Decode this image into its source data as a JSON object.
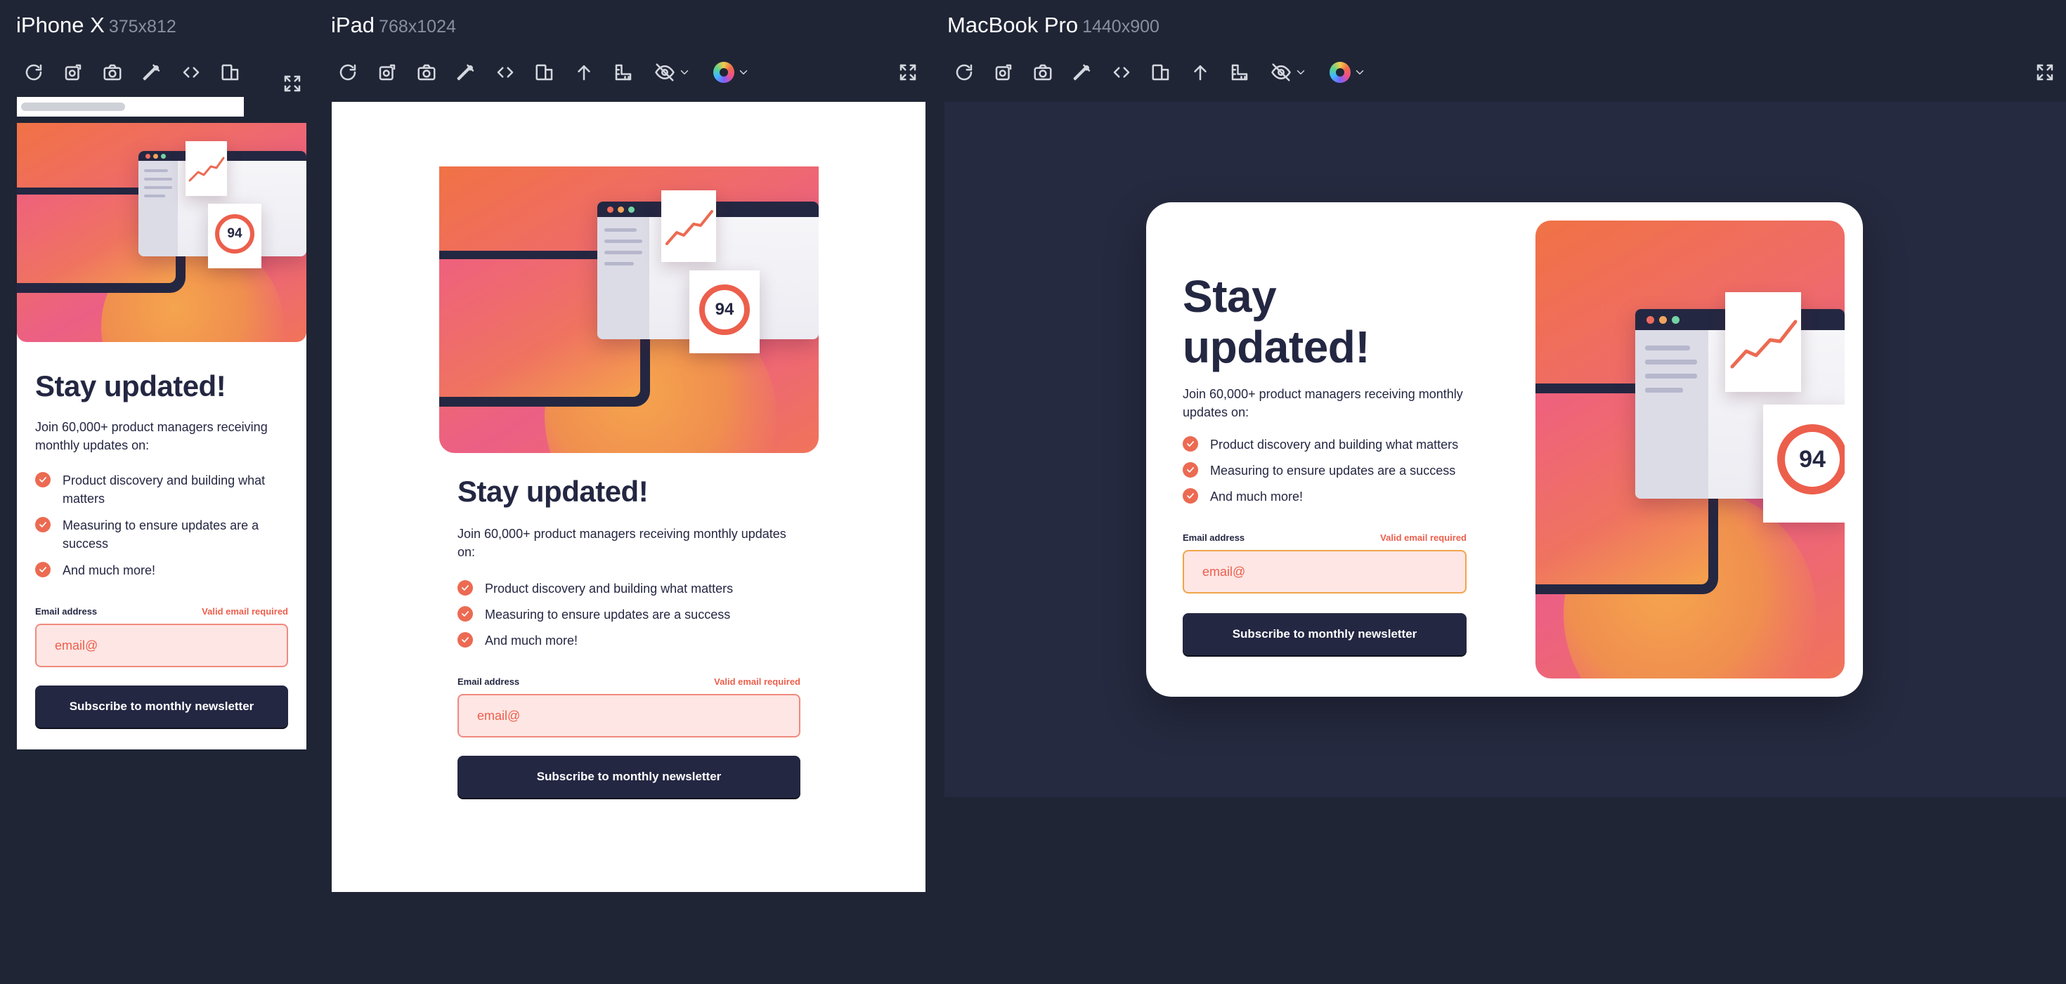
{
  "devices": {
    "iphone": {
      "name": "iPhone X",
      "dims": "375x812"
    },
    "ipad": {
      "name": "iPad",
      "dims": "768x1024"
    },
    "macbook": {
      "name": "MacBook Pro",
      "dims": "1440x900"
    }
  },
  "toolbar_icons": [
    "refresh-icon",
    "screenshot-target-icon",
    "camera-icon",
    "eyedropper-icon",
    "code-icon",
    "device-frame-icon",
    "arrow-up-icon",
    "ruler-icon",
    "eye-off-icon",
    "color-palette-icon",
    "fullscreen-icon"
  ],
  "newsletter": {
    "title": "Stay updated!",
    "intro": "Join 60,000+ product managers receiving monthly updates on:",
    "features": [
      "Product discovery and building what matters",
      "Measuring to ensure updates are a success",
      "And much more!"
    ],
    "email_label": "Email address",
    "email_error": "Valid email required",
    "email_value": "email@",
    "submit_label": "Subscribe to monthly newsletter",
    "score": "94"
  },
  "colors": {
    "page_bg": "#1f2535",
    "navy": "#242742",
    "tomato": "#ec5f4c",
    "error_bg": "#fde6e4",
    "gradient_start": "#f07245",
    "gradient_end": "#ec5f85"
  }
}
